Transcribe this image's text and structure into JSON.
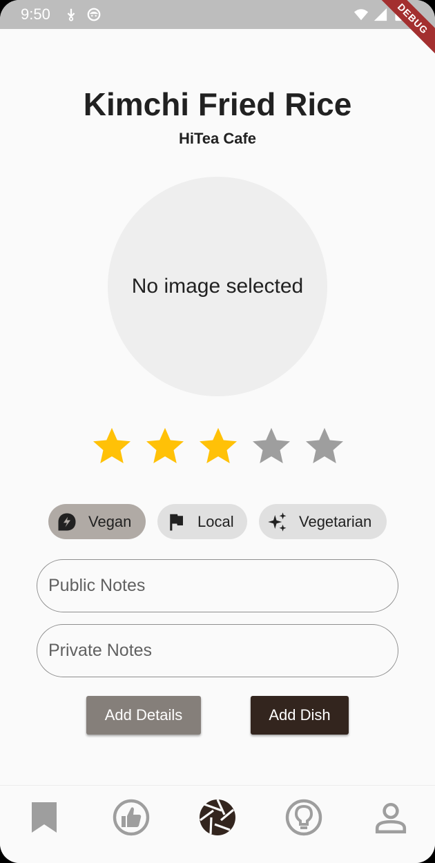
{
  "status_bar": {
    "time": "9:50",
    "debug_label": "DEBUG"
  },
  "dish": {
    "title": "Kimchi Fried Rice",
    "restaurant": "HiTea Cafe",
    "image_placeholder": "No image selected",
    "rating": 3,
    "rating_max": 5
  },
  "chips": [
    {
      "label": "Vegan",
      "icon": "vegan-icon",
      "selected": true
    },
    {
      "label": "Local",
      "icon": "flag-icon",
      "selected": false
    },
    {
      "label": "Vegetarian",
      "icon": "sparkle-icon",
      "selected": false
    }
  ],
  "inputs": {
    "public_notes_placeholder": "Public Notes",
    "private_notes_placeholder": "Private Notes"
  },
  "buttons": {
    "add_details": "Add Details",
    "add_dish": "Add Dish"
  },
  "bottom_nav": [
    {
      "icon": "bookmark-icon",
      "active": false
    },
    {
      "icon": "thumbs-up-icon",
      "active": false
    },
    {
      "icon": "camera-shutter-icon",
      "active": true
    },
    {
      "icon": "lightbulb-icon",
      "active": false
    },
    {
      "icon": "person-icon",
      "active": false
    }
  ],
  "colors": {
    "star_filled": "#ffc107",
    "star_empty": "#9e9e9e",
    "chip_selected": "#b0aaa5",
    "chip_default": "#e0e0e0",
    "button_secondary": "#857f7a",
    "button_primary": "#33251e",
    "nav_inactive": "#9e9e9e",
    "nav_active": "#33251e"
  }
}
